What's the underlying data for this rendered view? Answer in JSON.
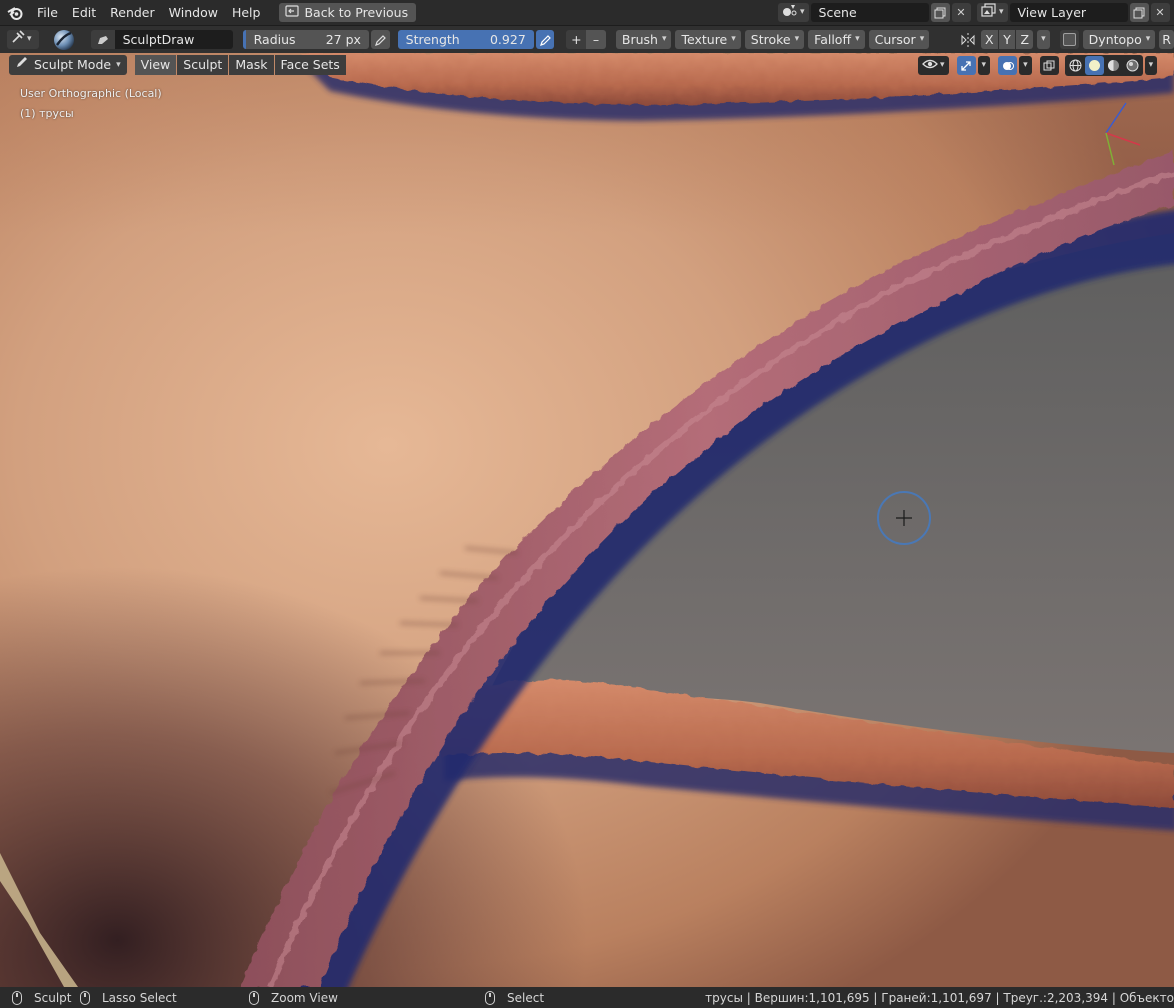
{
  "menu": {
    "items": [
      "File",
      "Edit",
      "Render",
      "Window",
      "Help"
    ],
    "back_button": "Back to Previous",
    "scene_label": "Scene",
    "view_layer_label": "View Layer"
  },
  "tool_header": {
    "brush_name": "SculptDraw",
    "radius_label": "Radius",
    "radius_value": "27 px",
    "strength_label": "Strength",
    "strength_value": "0.927",
    "plus": "+",
    "minus": "–",
    "menus": [
      "Brush",
      "Texture",
      "Stroke",
      "Falloff",
      "Cursor"
    ],
    "axes": [
      "X",
      "Y",
      "Z"
    ],
    "dyntopo_label": "Dyntopo",
    "cut_label": "R"
  },
  "viewport": {
    "mode_label": "Sculpt Mode",
    "tabs": [
      "View",
      "Sculpt",
      "Mask",
      "Face Sets"
    ],
    "view_name": "User Orthographic (Local)",
    "object_name": "(1) трусы"
  },
  "status": {
    "left_action": "Sculpt",
    "middle_action": "Lasso Select",
    "zoom_action": "Zoom View",
    "select_action": "Select",
    "stats": "трусы | Вершин:1,101,695 | Граней:1,101,697 | Треуг.:2,203,394 | Объекто"
  },
  "colors": {
    "accent_blue": "#4772b3",
    "skin_base": "#c58f6e",
    "band_pink": "#a4606b",
    "band_orange": "#c97a5a",
    "background_grey": "#6e6c6b"
  },
  "icons": [
    "blender-logo-icon",
    "back-icon",
    "scene-icon",
    "view-layer-icon",
    "copy-icon",
    "close-icon",
    "brush-icon",
    "pen-pressure-icon",
    "symmetry-icon",
    "visibility-icon",
    "gizmo-icon",
    "overlay-icon",
    "xray-icon",
    "shading-icons"
  ]
}
